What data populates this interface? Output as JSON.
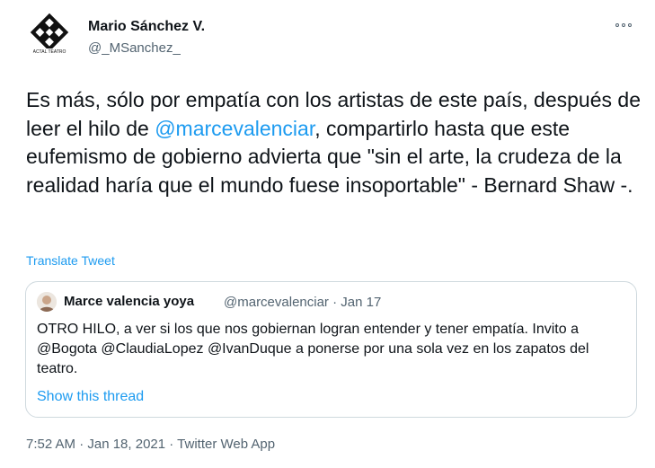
{
  "author": {
    "display_name": "Mario Sánchez V.",
    "handle": "@_MSanchez_",
    "avatar_icon": "actal-teatro-logo",
    "avatar_caption": "ACTAL TEATRO"
  },
  "more_icon": "more-options-icon",
  "tweet": {
    "text_part1": "Es más, sólo por empatía con los artistas de este país, después de leer el hilo de ",
    "mention": "@marcevalenciar",
    "text_part2": ", compartirlo hasta que este eufemismo de gobierno advierta que \"sin el arte, la crudeza de la realidad haría que el mundo fuese insoportable\" - Bernard Shaw -.",
    "translate_label": "Translate Tweet"
  },
  "quoted": {
    "name": "Marce valencia yoya",
    "meta": "@marcevalenciar · Jan 17",
    "text": "OTRO HILO, a ver si los que nos gobiernan logran entender y tener empatía. Invito a @Bogota @ClaudiaLopez @IvanDuque a ponerse por una sola vez en los zapatos del teatro.",
    "show_thread": "Show this thread"
  },
  "footer": {
    "timestamp": "7:52 AM · Jan 18, 2021 · Twitter Web App"
  },
  "colors": {
    "link": "#1d9bf0",
    "secondary_text": "#536471",
    "border": "#cfd9de"
  }
}
